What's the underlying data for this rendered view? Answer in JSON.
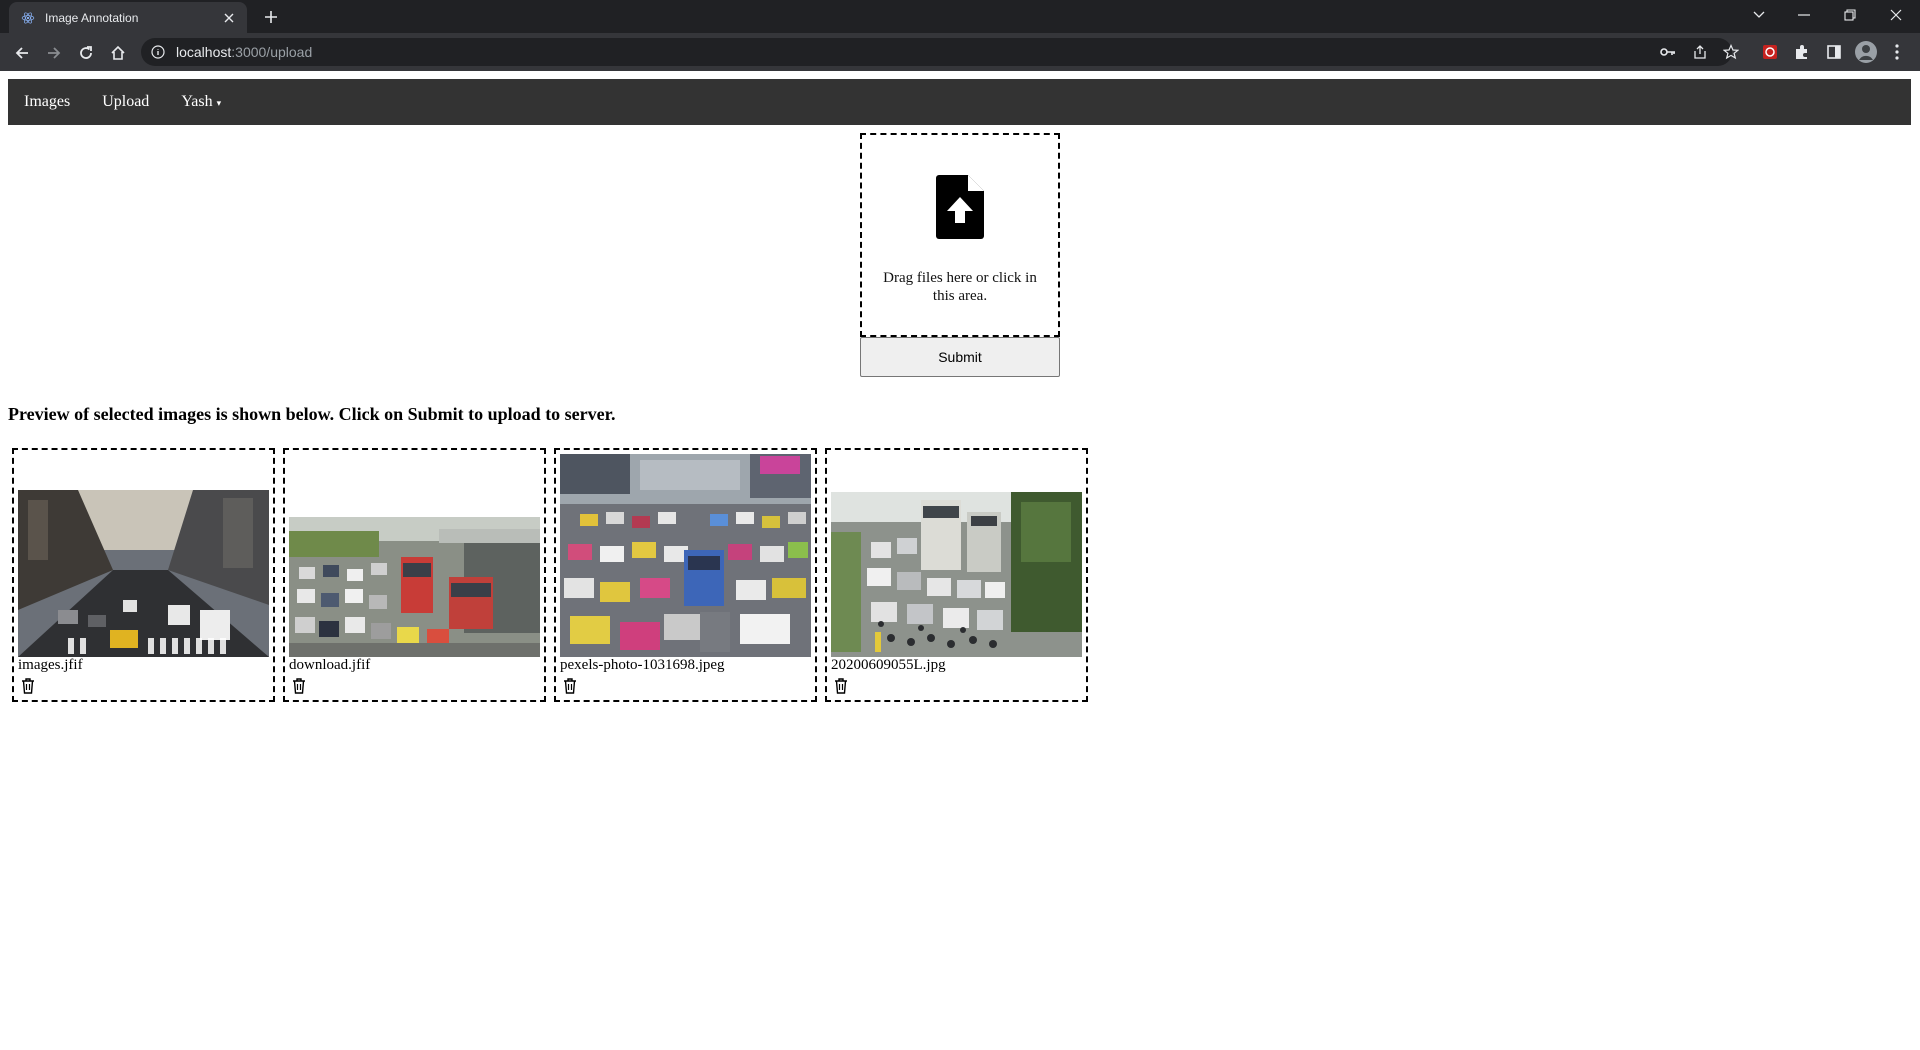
{
  "browser": {
    "tab_title": "Image Annotation",
    "url_host": "localhost",
    "url_rest": ":3000/upload"
  },
  "nav": {
    "items": [
      {
        "label": "Images"
      },
      {
        "label": "Upload"
      },
      {
        "label": "Yash",
        "caret": "▾"
      }
    ]
  },
  "dropzone": {
    "icon": "file-upload-icon",
    "text": "Drag files here or click in this area."
  },
  "submit_label": "Submit",
  "preview": {
    "heading": "Preview of selected images is shown below. Click on Submit to upload to server.",
    "files": [
      {
        "name": "images.jfif",
        "scene": "city-street-traffic"
      },
      {
        "name": "download.jfif",
        "scene": "bus-traffic-jam"
      },
      {
        "name": "pexels-photo-1031698.jpeg",
        "scene": "multi-lane-traffic"
      },
      {
        "name": "20200609055L.jpg",
        "scene": "scooters-and-buses"
      }
    ]
  },
  "colors": {
    "chrome_dark": "#202124",
    "chrome_mid": "#35363a",
    "app_nav": "#333333",
    "dashed_border": "#000000"
  }
}
